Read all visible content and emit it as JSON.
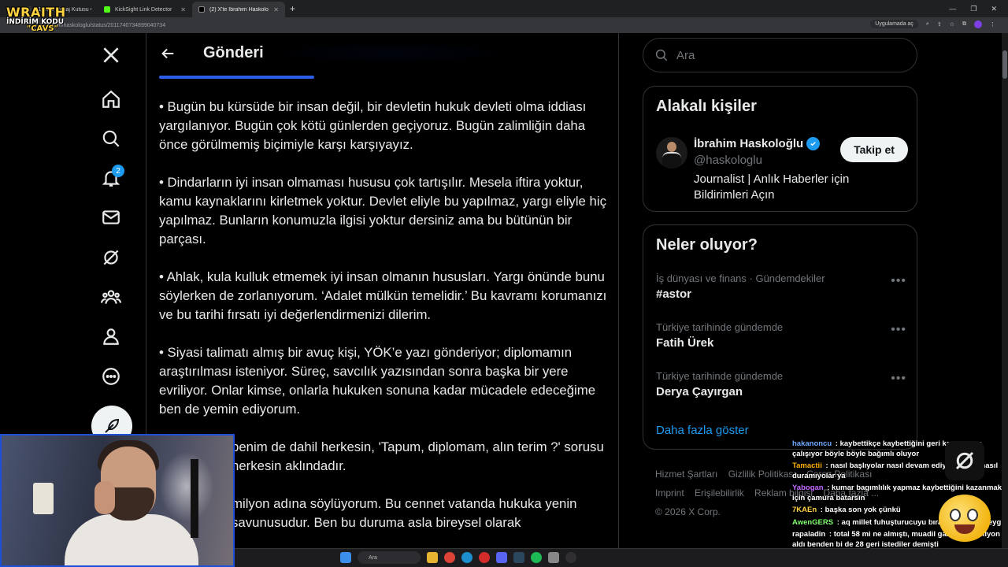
{
  "browser": {
    "tabs": [
      {
        "label": "(1) X'te Mesaj Kutusu • KÖZE"
      },
      {
        "label": "KickSight Link Detector"
      },
      {
        "label": "(2) X'te İbrahim Haskoloğlu: \"B"
      }
    ],
    "url": "x.com/haskologlu/status/2011740734899040734",
    "open_app_label": "Uygulamada aç"
  },
  "overlay_logo": {
    "line1": "WRAITH",
    "line2": "İNDİRİM KODU",
    "line3": "\"CAVS\""
  },
  "nav": {
    "notification_count": "2"
  },
  "header": {
    "title": "Gönderi"
  },
  "article": {
    "paragraphs": [
      "• Bugün bu kürsüde bir insan değil, bir devletin hukuk devleti olma iddiası yargılanıyor. Bugün çok kötü günlerden geçiyoruz. Bugün zalimliğin daha önce görülmemiş biçimiyle karşı karşıyayız.",
      "• Dindarların iyi insan olmaması hususu çok tartışılır. Mesela iftira yoktur, kamu kaynaklarını kirletmek yoktur. Devlet eliyle bu yapılmaz, yargı eliyle hiç yapılmaz. Bunların konumuzla ilgisi yoktur dersiniz ama bu bütünün bir parçası.",
      "• Ahlak, kula kulluk etmemek iyi insan olmanın hususları. Yargı önünde bunu söylerken de zorlanıyorum. ‘Adalet mülkün temelidir.’ Bu kavramı korumanızı ve bu tarihi fırsatı iyi değerlendirmenizi dilerim.",
      "• Siyasi talimatı almış bir avuç kişi, YÖK’e yazı gönderiyor; diplomamın araştırılması isteniyor. Süreç, savcılık yazısından sonra başka bir yere evriliyor. Onlar kimse, onlarla hukuken sonuna kadar mücadele edeceğime ben de yemin ediyorum.",
      "benim de dahil herkesin, 'Tapum, diplomam, alın terim ?' sorusu herkesin aklındadır.",
      "milyon adına söylüyorum. Bu cennet vatanda hukuka yenin savunusudur. Ben bu duruma asla bireysel olarak"
    ]
  },
  "search": {
    "placeholder": "Ara"
  },
  "related": {
    "title": "Alakalı kişiler",
    "person": {
      "name": "İbrahim Haskoloğlu",
      "handle": "@haskologlu",
      "bio": "Journalist | Anlık Haberler için Bildirimleri Açın",
      "follow_label": "Takip et"
    }
  },
  "trends": {
    "title": "Neler oluyor?",
    "items": [
      {
        "meta": "İş dünyası ve finans · Gündemdekiler",
        "name": "#astor"
      },
      {
        "meta": "Türkiye tarihinde gündemde",
        "name": "Fatih Ürek"
      },
      {
        "meta": "Türkiye tarihinde gündemde",
        "name": "Derya Çayırgan"
      }
    ],
    "show_more": "Daha fazla göster"
  },
  "footer": {
    "links": [
      "Hizmet Şartları",
      "Gizlilik Politikası",
      "Çerez Politikası",
      "Imprint",
      "Erişilebilirlik",
      "Reklam bilgisi",
      "Daha fazla ..."
    ],
    "copyright": "© 2026 X Corp."
  },
  "chat": [
    {
      "user": "hakanoncu",
      "text": "kaybettikçe kaybettiğini geri kazanmaya çalışıyor böyle böyle bağımlı oluyor"
    },
    {
      "user": "Tamactii",
      "text": "nasıl başlıyolar nasıl devam ediyolar veya nasıl duramıyolar ya"
    },
    {
      "user": "Yabogan",
      "text": "kumar bagımlılık yapmaz kaybettiğini kazanmak için çamura batarsın"
    },
    {
      "user": "7KAEn",
      "text": "başka son yok çünkü"
    },
    {
      "user": "AwenGERS",
      "text": "aq millet fuhuşturucuyu bırakıyo kumar neyg"
    },
    {
      "user": "rapaladin",
      "text": "total 58 mi ne almıştı, muadil gaziler 1.5 milyon aldı benden bi de 28 geri istediler demişti"
    }
  ],
  "taskbar": {
    "search_placeholder": "Ara"
  }
}
